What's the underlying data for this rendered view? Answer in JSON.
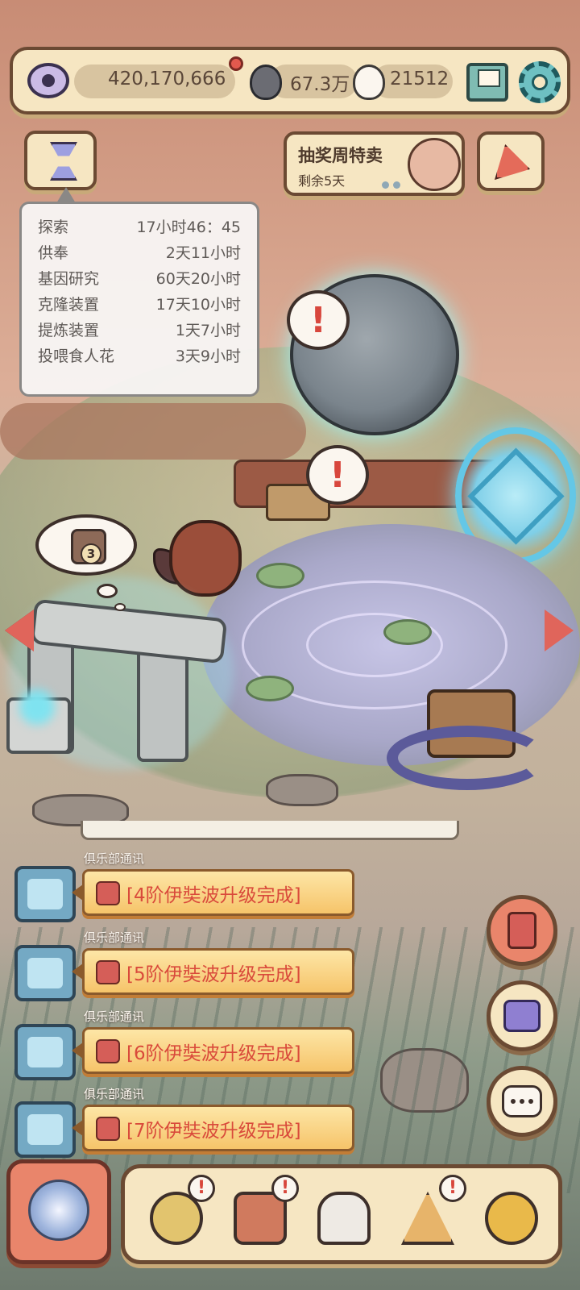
{
  "resources": {
    "eye_points": "420,170,666",
    "souls": "67.3万",
    "ghosts": "21512"
  },
  "timers": {
    "rows": [
      {
        "label": "探索",
        "value": "17小时46：45"
      },
      {
        "label": "供奉",
        "value": "2天11小时"
      },
      {
        "label": "基因研究",
        "value": "60天20小时"
      },
      {
        "label": "克隆装置",
        "value": "17天10小时"
      },
      {
        "label": "提炼装置",
        "value": "1天7小时"
      },
      {
        "label": "投喂食人花",
        "value": "3天9小时"
      }
    ]
  },
  "promo": {
    "title": "抽奖周特卖",
    "subtitle": "剩余5天"
  },
  "alerts": {
    "mark": "!",
    "thought_badge": "3"
  },
  "messages": [
    {
      "sender": "俱乐部通讯",
      "text": "[4阶伊奘波升级完成]"
    },
    {
      "sender": "俱乐部通讯",
      "text": "[5阶伊奘波升级完成]"
    },
    {
      "sender": "俱乐部通讯",
      "text": "[6阶伊奘波升级完成]"
    },
    {
      "sender": "俱乐部通讯",
      "text": "[7阶伊奘波升级完成]"
    }
  ],
  "icons": {
    "top": [
      "eye-icon",
      "soul-orb-icon",
      "ghost-icon",
      "mail-icon",
      "gear-icon"
    ],
    "bottom": [
      "creature-icon",
      "backpack-icon",
      "bust-statue-icon",
      "pyramid-eye-icon",
      "key-coin-icon"
    ]
  },
  "colors": {
    "panel": "#f6e6c2",
    "panel_border": "#6b4a33",
    "alert_red": "#d8473d",
    "message_text": "#d94a3b"
  }
}
